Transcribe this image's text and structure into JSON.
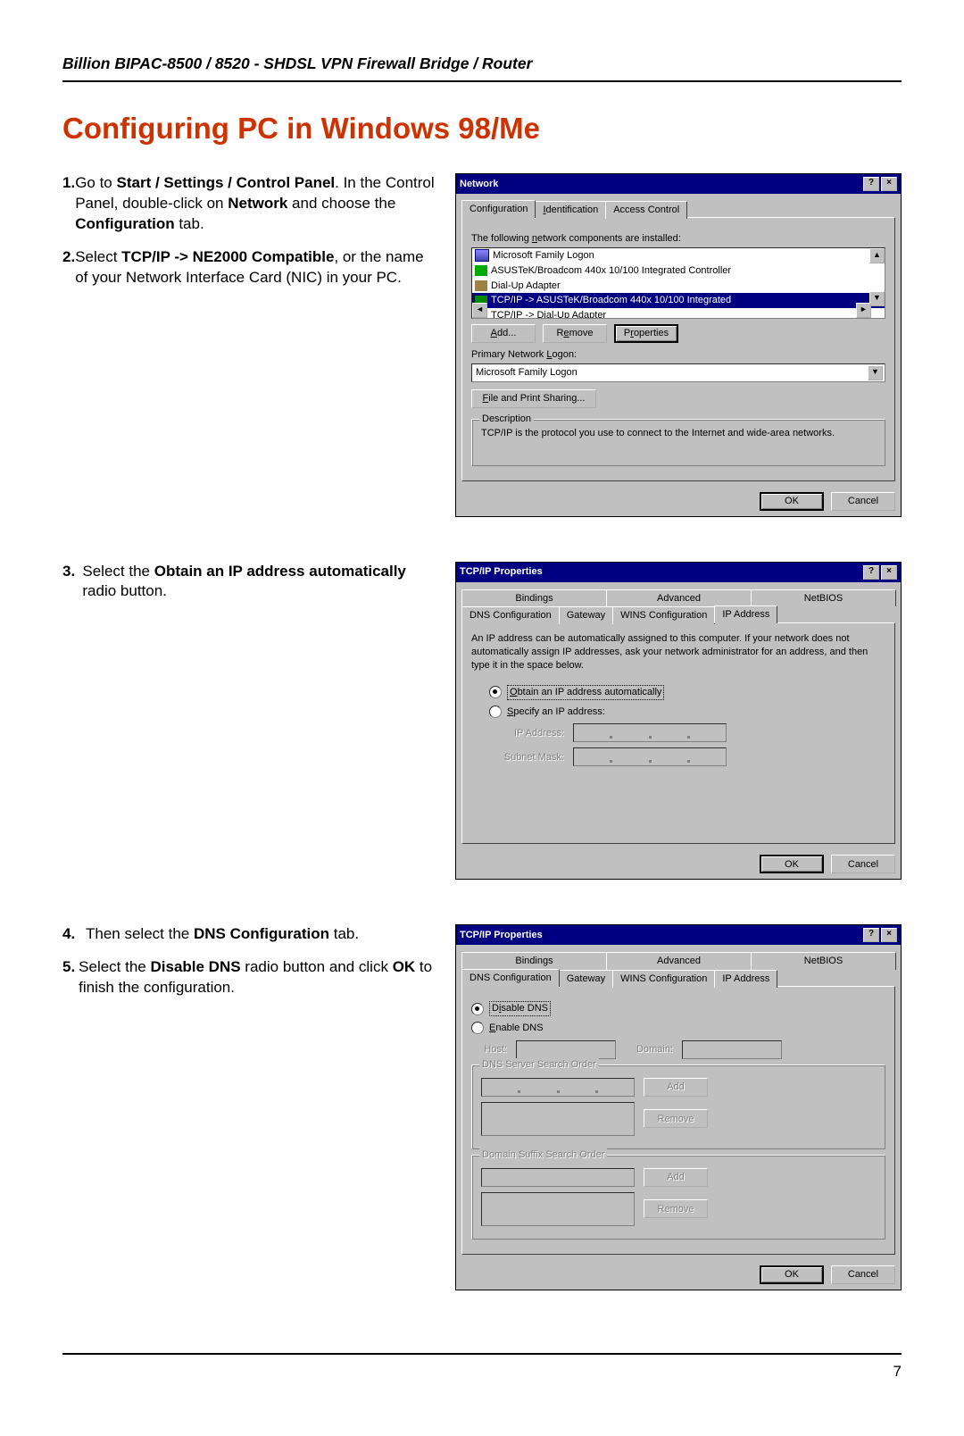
{
  "header": "Billion BIPAC-8500 / 8520 - SHDSL VPN Firewall Bridge / Router",
  "title": "Configuring PC in Windows 98/Me",
  "steps": {
    "s1a": "1.",
    "s1b": "Go to ",
    "s1c": "Start / Settings / Control Panel",
    "s1d": ". In the Control Panel, double-click on ",
    "s1e": "Network",
    "s1f": " and choose the ",
    "s1g": "Configuration",
    "s1h": " tab.",
    "s2a": "2.",
    "s2b": "Select ",
    "s2c": "TCP/IP -> NE2000 Compatible",
    "s2d": ", or the name of your Network Interface Card (NIC) in your PC.",
    "s3a": "3.",
    "s3b": "Select the ",
    "s3c": "Obtain an IP address automatically",
    "s3d": " radio button.",
    "s4a": "4.",
    "s4b": "Then select the ",
    "s4c": "DNS Configuration",
    "s4d": " tab.",
    "s5a": "5.",
    "s5b": "Select the ",
    "s5c": "Disable DNS",
    "s5d": " radio button and click ",
    "s5e": "OK",
    "s5f": " to finish the configuration."
  },
  "dlg1": {
    "title": "Network",
    "tab1": "Configuration",
    "tab2": "Identification",
    "tab3": "Access Control",
    "listlabel": "The following network components are installed:",
    "items": {
      "i0": "Microsoft Family Logon",
      "i1": "ASUSTeK/Broadcom 440x 10/100 Integrated Controller",
      "i2": "Dial-Up Adapter",
      "i3": "TCP/IP -> ASUSTeK/Broadcom 440x 10/100 Integrated",
      "i4": "TCP/IP -> Dial-Up Adapter"
    },
    "add": "Add...",
    "remove": "Remove",
    "properties": "Properties",
    "pnl_label": "Primary Network Logon:",
    "pnl_value": "Microsoft Family Logon",
    "fileshare": "File and Print Sharing...",
    "desc_legend": "Description",
    "desc_text": "TCP/IP is the protocol you use to connect to the Internet and wide-area networks.",
    "ok": "OK",
    "cancel": "Cancel"
  },
  "dlg2": {
    "title": "TCP/IP Properties",
    "tabs": {
      "t1": "Bindings",
      "t2": "Advanced",
      "t3": "NetBIOS",
      "t4": "DNS Configuration",
      "t5": "Gateway",
      "t6": "WINS Configuration",
      "t7": "IP Address"
    },
    "blurb": "An IP address can be automatically assigned to this computer. If your network does not automatically assign IP addresses, ask your network administrator for an address, and then type it in the space below.",
    "r1": "Obtain an IP address automatically",
    "r2": "Specify an IP address:",
    "ip_label": "IP Address:",
    "mask_label": "Subnet Mask:",
    "ok": "OK",
    "cancel": "Cancel"
  },
  "dlg3": {
    "title": "TCP/IP Properties",
    "r1": "Disable DNS",
    "r2": "Enable DNS",
    "host": "Host:",
    "domain": "Domain:",
    "dns_order": "DNS Server Search Order",
    "suffix_order": "Domain Suffix Search Order",
    "add": "Add",
    "remove": "Remove",
    "ok": "OK",
    "cancel": "Cancel"
  },
  "page_number": "7"
}
